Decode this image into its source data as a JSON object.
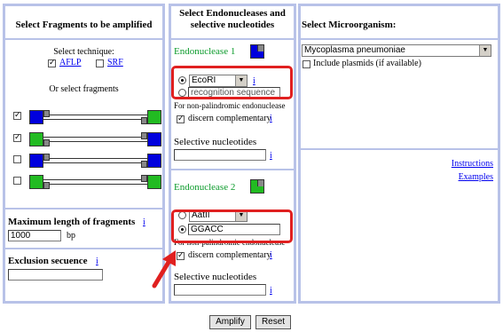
{
  "left": {
    "title": "Select Fragments to be amplified",
    "technique_label": "Select technique:",
    "aflp_label": "AFLP",
    "aflp_checked": true,
    "srf_label": "SRF",
    "srf_checked": false,
    "or_select_label": "Or select fragments",
    "fragments": [
      {
        "checked": true,
        "left_color": "#0000dd",
        "right_color": "#22bb22"
      },
      {
        "checked": true,
        "left_color": "#22bb22",
        "right_color": "#0000dd"
      },
      {
        "checked": false,
        "left_color": "#0000dd",
        "right_color": "#0000dd"
      },
      {
        "checked": false,
        "left_color": "#22bb22",
        "right_color": "#22bb22"
      }
    ],
    "max_length_label": "Maximum length of fragments",
    "max_length_value": "1000",
    "max_length_unit": "bp",
    "info_glyph": "i",
    "exclusion_label": "Exclusion secuence",
    "exclusion_value": ""
  },
  "middle": {
    "title_line1": "Select Endonucleases and",
    "title_line2": "selective nucleotides",
    "endo1_label": "Endonuclease 1",
    "endo1_select_value": "EcoRI",
    "endo1_recognition_placeholder": "recognition sequence",
    "endo1_nonpal_note": "For non-palindromic endonuclease",
    "endo1_discern_label": "discern complementary",
    "endo1_discern_checked": true,
    "endo1_selective_label": "Selective nucleotides",
    "endo1_selective_value": "",
    "endo2_label": "Endonuclease 2",
    "endo2_select_value": "AatII",
    "endo2_recognition_value": "GGACC",
    "endo2_nonpal_note": "For non-palindromic endonuclease",
    "endo2_discern_label": "discern complementary",
    "endo2_discern_checked": true,
    "endo2_selective_label": "Selective nucleotides",
    "endo2_selective_value": ""
  },
  "right": {
    "title": "Select Microorganism:",
    "organism_value": "Mycoplasma pneumoniae",
    "include_plasmids_label": "Include plasmids (if available)",
    "include_plasmids_checked": false,
    "instructions_link": "Instructions",
    "examples_link": "Examples"
  },
  "buttons": {
    "amplify": "Amplify",
    "reset": "Reset"
  },
  "colors": {
    "panel_border": "#b8c2e8",
    "highlight": "#e02020",
    "link": "#0000ee",
    "green_text": "#0a9a2a"
  }
}
